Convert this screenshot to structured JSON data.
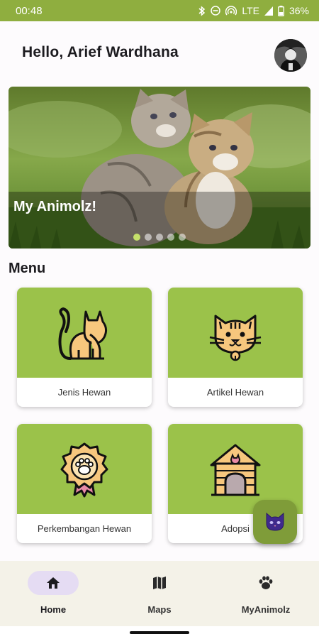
{
  "status_bar": {
    "time": "00:48",
    "network": "LTE",
    "battery": "36%"
  },
  "header": {
    "greeting": "Hello, Arief Wardhana"
  },
  "banner": {
    "title": "My Animolz!",
    "slide_count": 5,
    "active_slide": 1
  },
  "menu": {
    "title": "Menu",
    "items": [
      {
        "label": "Jenis Hewan",
        "icon": "cat-sitting-icon"
      },
      {
        "label": "Artikel Hewan",
        "icon": "cat-face-icon"
      },
      {
        "label": "Perkembangan Hewan",
        "icon": "paw-badge-icon"
      },
      {
        "label": "Adopsi",
        "icon": "pet-house-icon"
      }
    ]
  },
  "fab": {
    "icon": "cat-head-icon"
  },
  "bottom_nav": {
    "items": [
      {
        "label": "Home",
        "icon": "home-icon",
        "active": true
      },
      {
        "label": "Maps",
        "icon": "map-icon",
        "active": false
      },
      {
        "label": "MyAnimolz",
        "icon": "paw-icon",
        "active": false
      }
    ]
  },
  "colors": {
    "status_bar": "#8fae3f",
    "card_accent": "#9bc24a",
    "fab": "#7f9c39",
    "nav_active_pill": "#e5dcf3",
    "nav_bg": "#f4f2e8"
  }
}
